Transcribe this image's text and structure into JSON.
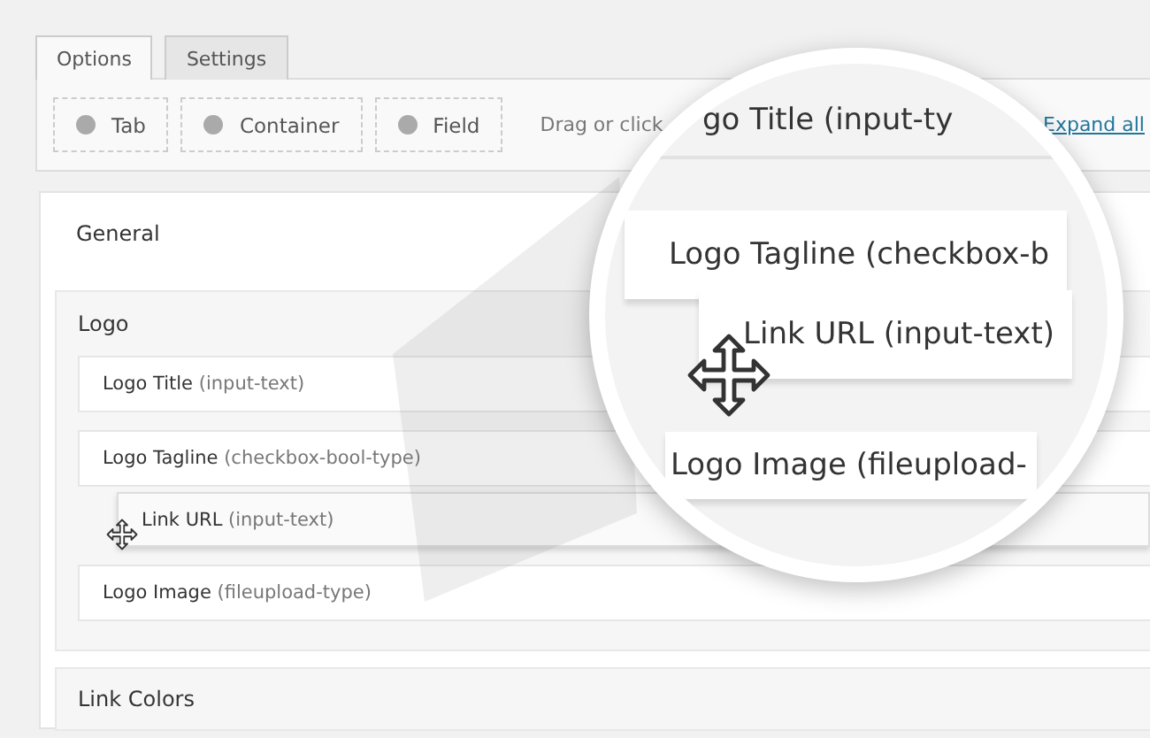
{
  "tabs": [
    {
      "label": "Options",
      "selected": true
    },
    {
      "label": "Settings",
      "selected": false
    }
  ],
  "toolbar": {
    "buttons": [
      {
        "label": "Tab"
      },
      {
        "label": "Container"
      },
      {
        "label": "Field"
      }
    ],
    "hint": "Drag or click",
    "link": "Expand all"
  },
  "sections": [
    {
      "title": "General"
    },
    {
      "title": "Logo",
      "fields": [
        {
          "label": "**Logo Title** (input-text)"
        },
        {
          "label": "**Logo Tagline** (checkbox-bool-type)"
        },
        {
          "label": "**Logo Image** (fileupload-type)"
        }
      ]
    },
    {
      "title": "Link Colors"
    }
  ],
  "dragged_field": {
    "label": "**Link URL** (input-text)"
  },
  "magnifier": {
    "rows": [
      {
        "label": "go Title (input-ty",
        "kind": "top"
      },
      {
        "label": "Logo Tagline (checkbox-b",
        "kind": "row"
      },
      {
        "label": "Link URL (input-text)",
        "kind": "dragged"
      },
      {
        "label": "Logo Image (fileupload-",
        "kind": "bottom"
      }
    ]
  }
}
